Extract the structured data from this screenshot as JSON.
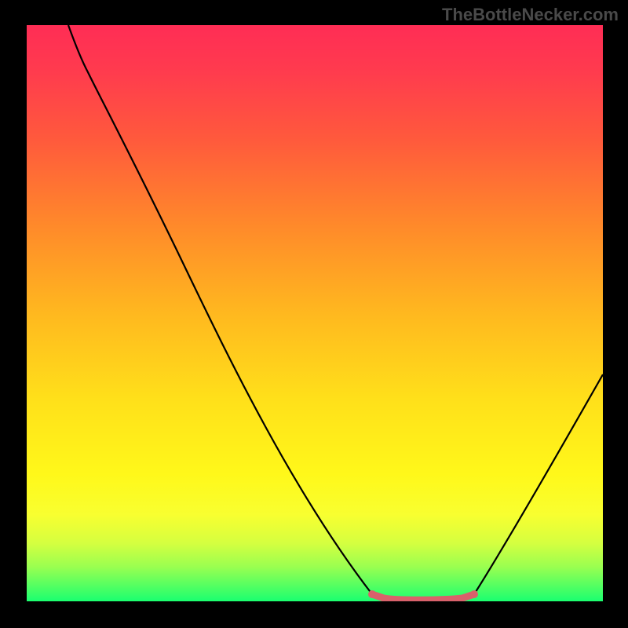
{
  "watermark": "TheBottleNecker.com",
  "chart_data": {
    "type": "line",
    "title": "",
    "xlabel": "",
    "ylabel": "",
    "xlim": [
      0,
      100
    ],
    "ylim": [
      0,
      100
    ],
    "series": [
      {
        "name": "curve",
        "x": [
          7,
          11,
          20,
          30,
          40,
          50,
          60,
          62,
          70,
          75,
          78,
          85,
          95,
          100
        ],
        "y": [
          100,
          92,
          78,
          58,
          42,
          28,
          1,
          0,
          0,
          0,
          1,
          14,
          30,
          40
        ]
      }
    ],
    "highlight_region": {
      "x_start": 60,
      "x_end": 78,
      "color": "#d9616b"
    },
    "background_gradient": {
      "direction": "top-to-bottom",
      "stops": [
        {
          "pos": 0.0,
          "color": "#ff2d55"
        },
        {
          "pos": 0.5,
          "color": "#ffb81f"
        },
        {
          "pos": 0.78,
          "color": "#fff81a"
        },
        {
          "pos": 1.0,
          "color": "#1aff70"
        }
      ]
    }
  }
}
